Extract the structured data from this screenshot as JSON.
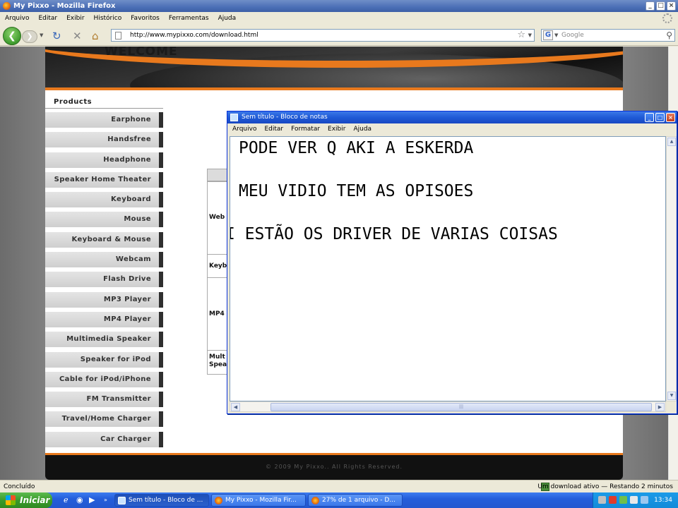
{
  "browser": {
    "title": "My Pixxo - Mozilla Firefox",
    "menu": [
      "Arquivo",
      "Editar",
      "Exibir",
      "Histórico",
      "Favoritos",
      "Ferramentas",
      "Ajuda"
    ],
    "url": "http://www.mypixxo.com/download.html",
    "search_placeholder": "Google",
    "status_left": "Concluído",
    "status_right": "Um download ativo — Restando 2 minutos"
  },
  "site": {
    "banner_text": "WELCOME",
    "sidebar_header": "Products",
    "products": [
      "Earphone",
      "Handsfree",
      "Headphone",
      "Speaker Home Theater",
      "Keyboard",
      "Mouse",
      "Keyboard & Mouse",
      "Webcam",
      "Flash Drive",
      "MP3 Player",
      "MP4 Player",
      "Multimedia Speaker",
      "Speaker for iPod",
      "Cable for iPod/iPhone",
      "FM Transmitter",
      "Travel/Home Charger",
      "Car Charger"
    ],
    "table_cells": [
      "Web",
      "Keyb",
      "MP4",
      "Mult Spea"
    ],
    "footer": "© 2009 My Pixxo.. All Rights Reserved."
  },
  "notepad": {
    "title": "Sem título - Bloco de notas",
    "menu": [
      "Arquivo",
      "Editar",
      "Formatar",
      "Exibir",
      "Ajuda"
    ],
    "lines": [
      "PODE VER Q AKI A ESKERDA",
      "MEU VIDIO TEM AS OPISOES",
      "I ESTÃO OS DRIVER DE VARIAS COISAS"
    ]
  },
  "taskbar": {
    "start_label": "Iniciar",
    "items": [
      "Sem título - Bloco de ...",
      "My Pixxo - Mozilla Fir...",
      "27% de 1 arquivo - D..."
    ],
    "clock": "13:34"
  },
  "colors": {
    "accent_orange": "#e8791d",
    "xp_blue": "#245edb",
    "start_green": "#3b9b2b"
  }
}
